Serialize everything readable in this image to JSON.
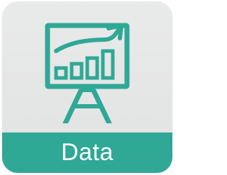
{
  "app_tile": {
    "label": "Data",
    "icon": "presentation-growth-chart-icon",
    "accent_color": "#2fa896",
    "background_color": "#e5e6e6",
    "label_text_color": "#ffffff"
  }
}
